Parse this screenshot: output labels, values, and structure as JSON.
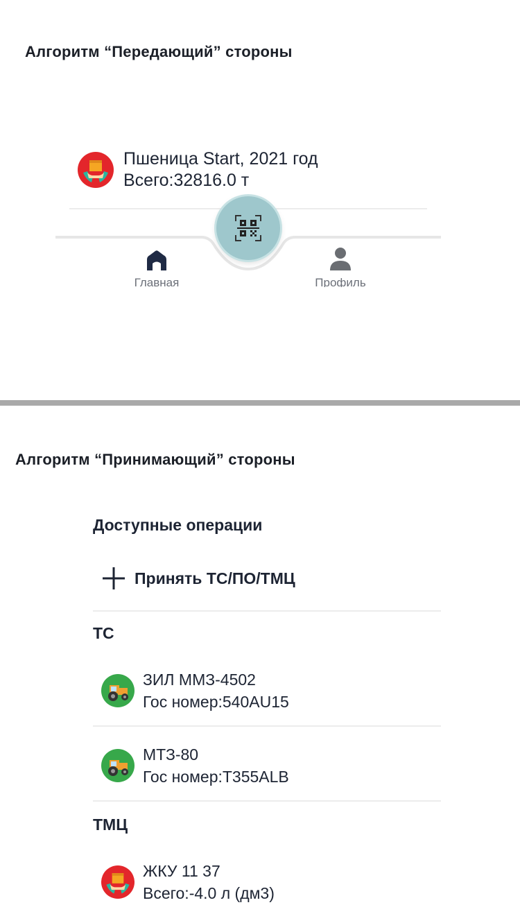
{
  "sender": {
    "heading": "Алгоритм “Передающий” стороны",
    "product": {
      "name": "Пшеница Start, 2021 год",
      "total": "Всего:32816.0 т",
      "icon": "crate-hands-icon"
    },
    "nav": {
      "home": {
        "label": "Главная",
        "icon": "home-icon"
      },
      "scan": {
        "icon": "qr-code-icon"
      },
      "profile": {
        "label": "Профиль",
        "icon": "profile-icon"
      }
    }
  },
  "receiver": {
    "heading": "Алгоритм “Принимающий” стороны",
    "operations_title": "Доступные операции",
    "accept_label": "Принять ТС/ПО/ТМЦ",
    "vehicles": {
      "title": "ТС",
      "items": [
        {
          "name": "ЗИЛ ММЗ-4502",
          "plate": "Гос номер:540AU15",
          "icon": "tractor-icon"
        },
        {
          "name": "МТЗ-80",
          "plate": "Гос номер:T355ALB",
          "icon": "tractor-icon"
        }
      ]
    },
    "goods": {
      "title": "ТМЦ",
      "items": [
        {
          "name": "ЖКУ 11 37",
          "total": "Всего:-4.0 л (дм3)",
          "icon": "crate-hands-icon"
        }
      ]
    }
  },
  "colors": {
    "accent_red": "#e3262b",
    "accent_green": "#37a84a",
    "scan_button": "#9ec7cc",
    "nav_icon": "#1f2a44"
  }
}
